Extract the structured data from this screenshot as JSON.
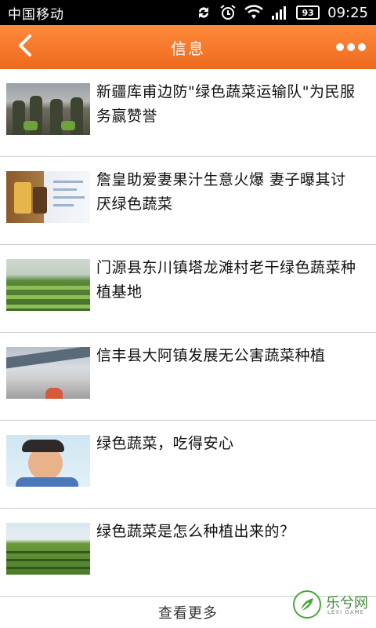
{
  "status_bar": {
    "carrier": "中国移动",
    "battery": "93",
    "time": "09:25",
    "icons": [
      "sync-icon",
      "alarm-icon",
      "wifi-icon",
      "signal-icon",
      "battery-icon"
    ]
  },
  "header": {
    "title": "信息",
    "accent_color": "#f07a2a"
  },
  "articles": [
    {
      "title": "新疆库甫边防\"绿色蔬菜运输队\"为民服务赢赞誉",
      "thumb": "soldiers-with-vegetables"
    },
    {
      "title": "詹皇助爱妻果汁生意火爆 妻子曝其讨厌绿色蔬菜",
      "thumb": "juice-drinks"
    },
    {
      "title": "门源县东川镇塔龙滩村老干绿色蔬菜种植基地",
      "thumb": "greenhouse-vegetables"
    },
    {
      "title": "信丰县大阿镇发展无公害蔬菜种植",
      "thumb": "greenhouse-worker"
    },
    {
      "title": "绿色蔬菜，吃得安心",
      "thumb": "smiling-boy"
    },
    {
      "title": "绿色蔬菜是怎么种植出来的？",
      "thumb": "vegetable-field"
    }
  ],
  "footer": {
    "view_more": "查看更多"
  },
  "watermark": {
    "text": "乐兮网",
    "sub": "LEXI GAME"
  }
}
